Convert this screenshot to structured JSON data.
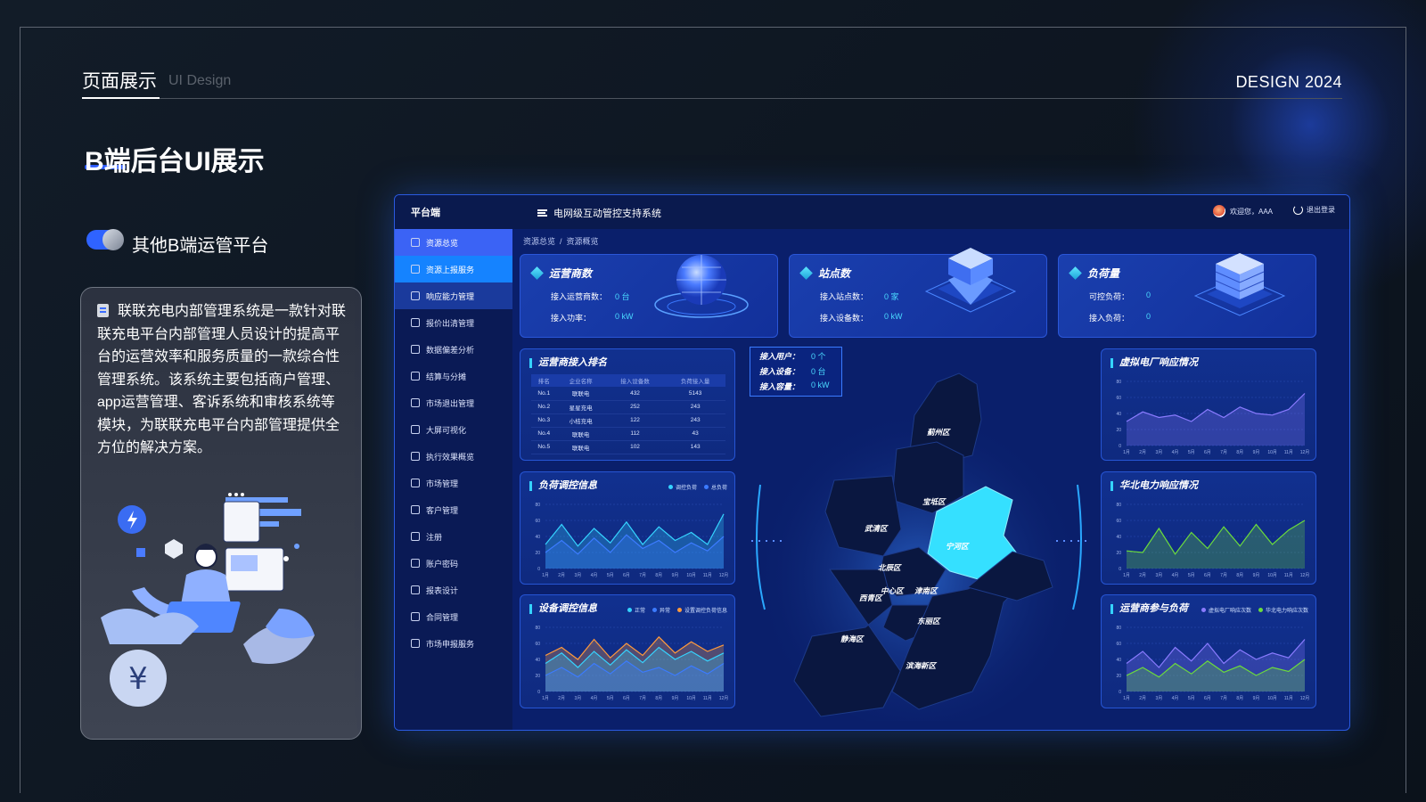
{
  "header": {
    "title": "页面展示",
    "subtitle": "UI Design",
    "year": "DESIGN 2024"
  },
  "page": {
    "title": "B端后台UI展示",
    "section_title": "其他B端运管平台",
    "description": "联联充电内部管理系统是一款针对联联充电平台内部管理人员设计的提高平台的运营效率和服务质量的一款综合性管理系统。该系统主要包括商户管理、app运营管理、客诉系统和审核系统等模块，为联联充电平台内部管理提供全方位的解决方案。"
  },
  "dash": {
    "platform": "平台端",
    "system_title": "电网级互动管控支持系统",
    "greeting": "欢迎您，AAA",
    "logout": "退出登录",
    "menu": [
      "资源总览",
      "资源上报服务",
      "响应能力管理",
      "报价出清管理",
      "数据偏差分析",
      "结算与分摊",
      "市场退出管理",
      "大屏可视化",
      "执行效果概览",
      "市场管理",
      "客户管理",
      "注册",
      "账户密码",
      "报表设计",
      "合同管理",
      "市场申报服务"
    ],
    "breadcrumb": [
      "资源总览",
      "资源概览"
    ],
    "kpis": [
      {
        "title": "运营商数",
        "rows": [
          {
            "label": "接入运营商数：",
            "value": "0 台"
          },
          {
            "label": "接入功率：",
            "value": "0 kW"
          }
        ]
      },
      {
        "title": "站点数",
        "rows": [
          {
            "label": "接入站点数：",
            "value": "0 家"
          },
          {
            "label": "接入设备数：",
            "value": "0 kW"
          }
        ]
      },
      {
        "title": "负荷量",
        "rows": [
          {
            "label": "可控负荷：",
            "value": "0"
          },
          {
            "label": "接入负荷：",
            "value": "0"
          }
        ]
      }
    ],
    "ranking": {
      "title": "运营商接入排名",
      "columns": [
        "排名",
        "企业名称",
        "接入设备数",
        "负荷接入量"
      ],
      "rows": [
        [
          "No.1",
          "联联电",
          "432",
          "5143"
        ],
        [
          "No.2",
          "星星充电",
          "252",
          "243"
        ],
        [
          "No.3",
          "小桔充电",
          "122",
          "243"
        ],
        [
          "No.4",
          "联联电",
          "112",
          "43"
        ],
        [
          "No.5",
          "联联电",
          "102",
          "143"
        ]
      ]
    },
    "charts": [
      {
        "title": "负荷调控信息",
        "legend": [
          "调控负荷",
          "总负荷"
        ]
      },
      {
        "title": "设备调控信息",
        "legend": [
          "正常",
          "异常",
          "设置调控负荷信息"
        ]
      },
      {
        "title": "虚拟电厂响应情况"
      },
      {
        "title": "华北电力响应情况"
      },
      {
        "title": "运营商参与负荷",
        "legend": [
          "虚拟电厂响应次数",
          "华北电力响应次数"
        ]
      }
    ],
    "map": {
      "info": [
        {
          "label": "接入用户：",
          "value": "0 个"
        },
        {
          "label": "接入设备：",
          "value": "0 台"
        },
        {
          "label": "接入容量：",
          "value": "0 kW"
        }
      ],
      "districts": [
        "蓟州区",
        "宝坻区",
        "武清区",
        "宁河区",
        "北辰区",
        "中心区",
        "津南区",
        "西青区",
        "东丽区",
        "静海区",
        "滨海新区"
      ]
    }
  },
  "chart_data": [
    {
      "type": "area",
      "title": "负荷调控信息",
      "categories": [
        "1月",
        "2月",
        "3月",
        "4月",
        "5月",
        "6月",
        "7月",
        "8月",
        "9月",
        "10月",
        "11月",
        "12月"
      ],
      "ylim": [
        0,
        80
      ],
      "yticks": [
        0,
        20,
        40,
        60,
        80
      ],
      "series": [
        {
          "name": "调控负荷",
          "color": "#35d3ff",
          "values": [
            30,
            55,
            28,
            50,
            32,
            58,
            30,
            52,
            35,
            45,
            30,
            68
          ]
        },
        {
          "name": "总负荷",
          "color": "#3c7bff",
          "values": [
            20,
            35,
            18,
            38,
            20,
            42,
            25,
            35,
            20,
            32,
            22,
            40
          ]
        }
      ]
    },
    {
      "type": "area",
      "title": "设备调控信息",
      "categories": [
        "1月",
        "2月",
        "3月",
        "4月",
        "5月",
        "6月",
        "7月",
        "8月",
        "9月",
        "10月",
        "11月",
        "12月"
      ],
      "ylim": [
        0,
        80
      ],
      "yticks": [
        0,
        20,
        40,
        60,
        80
      ],
      "series": [
        {
          "name": "设置调控负荷信息",
          "color": "#ff9a3c",
          "values": [
            45,
            55,
            40,
            65,
            42,
            60,
            45,
            68,
            48,
            62,
            50,
            58
          ]
        },
        {
          "name": "正常",
          "color": "#35d3ff",
          "values": [
            35,
            48,
            30,
            50,
            33,
            52,
            36,
            55,
            40,
            50,
            38,
            48
          ]
        },
        {
          "name": "异常",
          "color": "#3c7bff",
          "values": [
            20,
            30,
            18,
            35,
            22,
            38,
            24,
            30,
            20,
            32,
            22,
            35
          ]
        }
      ]
    },
    {
      "type": "area",
      "title": "虚拟电厂响应情况",
      "categories": [
        "1月",
        "2月",
        "3月",
        "4月",
        "5月",
        "6月",
        "7月",
        "8月",
        "9月",
        "10月",
        "11月",
        "12月"
      ],
      "ylim": [
        0,
        80
      ],
      "yticks": [
        0,
        20,
        40,
        60,
        80
      ],
      "series": [
        {
          "color": "#8a7bff",
          "values": [
            30,
            42,
            35,
            38,
            30,
            45,
            35,
            48,
            40,
            38,
            45,
            65
          ]
        }
      ]
    },
    {
      "type": "area",
      "title": "华北电力响应情况",
      "categories": [
        "1月",
        "2月",
        "3月",
        "4月",
        "5月",
        "6月",
        "7月",
        "8月",
        "9月",
        "10月",
        "11月",
        "12月"
      ],
      "ylim": [
        0,
        80
      ],
      "yticks": [
        0,
        20,
        40,
        60,
        80
      ],
      "series": [
        {
          "color": "#6cdc3c",
          "values": [
            22,
            20,
            50,
            18,
            45,
            25,
            52,
            28,
            55,
            30,
            48,
            60
          ]
        }
      ]
    },
    {
      "type": "area",
      "title": "运营商参与负荷",
      "categories": [
        "1月",
        "2月",
        "3月",
        "4月",
        "5月",
        "6月",
        "7月",
        "8月",
        "9月",
        "10月",
        "11月",
        "12月"
      ],
      "ylim": [
        0,
        80
      ],
      "yticks": [
        0,
        20,
        40,
        60,
        80
      ],
      "series": [
        {
          "name": "虚拟电厂响应次数",
          "color": "#8a7bff",
          "values": [
            35,
            50,
            30,
            55,
            38,
            60,
            35,
            52,
            40,
            48,
            42,
            65
          ]
        },
        {
          "name": "华北电力响应次数",
          "color": "#6cdc3c",
          "values": [
            20,
            30,
            18,
            35,
            22,
            38,
            24,
            32,
            20,
            30,
            25,
            40
          ]
        }
      ]
    }
  ]
}
